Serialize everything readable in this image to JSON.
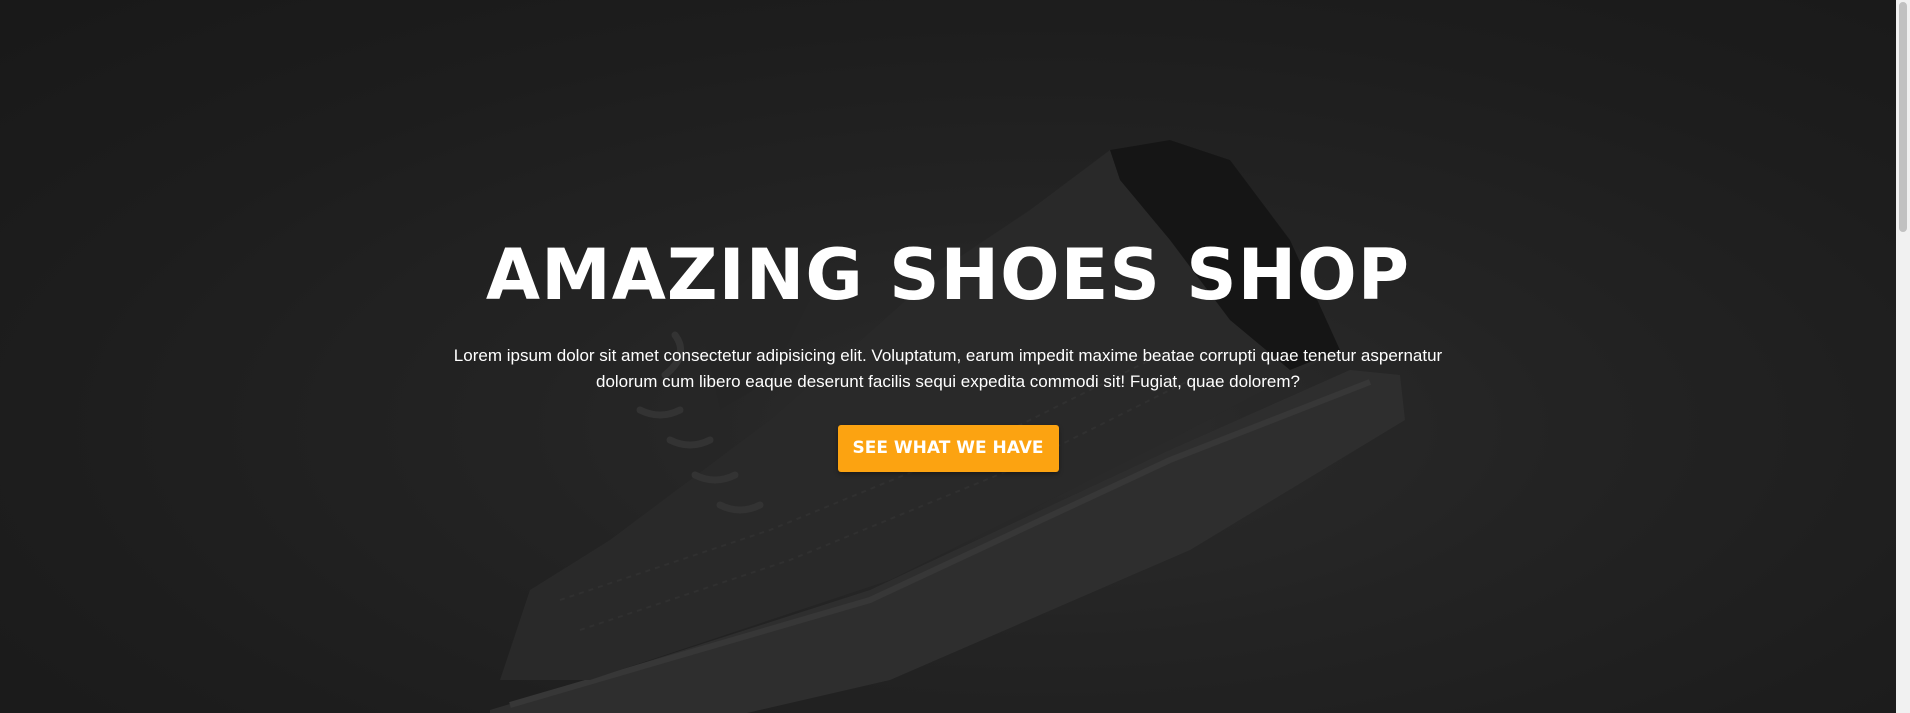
{
  "hero": {
    "title": "AMAZING SHOES SHOP",
    "subtitle": "Lorem ipsum dolor sit amet consectetur adipisicing elit. Voluptatum, earum impedit maxime beatae corrupti quae tenetur aspernatur dolorum cum libero eaque deserunt facilis sequi expedita commodi sit! Fugiat, quae dolorem?",
    "cta_label": "SEE WHAT WE HAVE",
    "background_image": "sneaker-photo",
    "accent_color": "#fca311"
  }
}
